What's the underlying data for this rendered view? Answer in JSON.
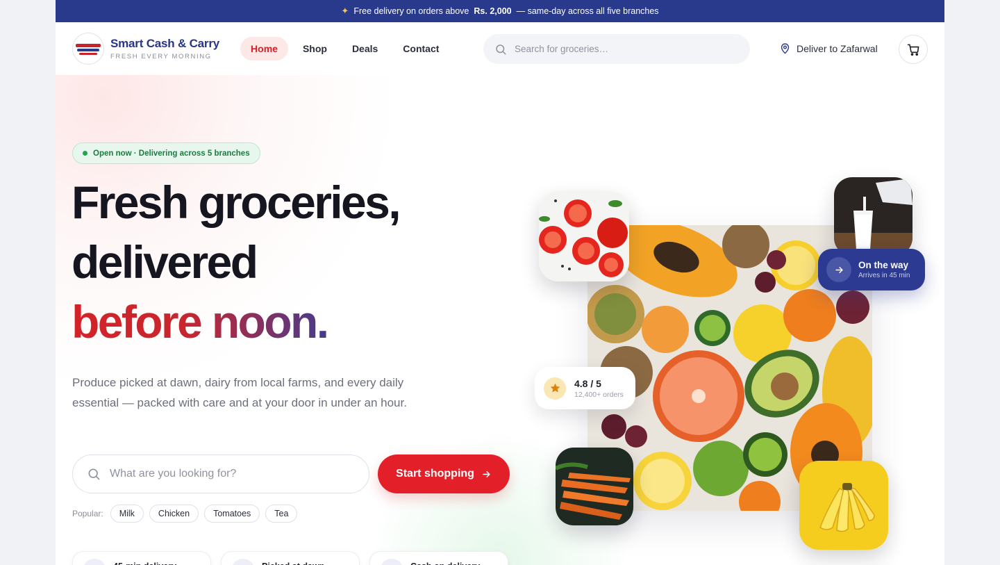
{
  "announcement": {
    "prefix": "Free delivery on orders above",
    "amount": "Rs. 2,000",
    "suffix": "— same-day across all five branches"
  },
  "brand": {
    "name": "Smart Cash & Carry",
    "tagline": "FRESH EVERY MORNING"
  },
  "nav": {
    "items": [
      {
        "label": "Home",
        "active": true
      },
      {
        "label": "Shop",
        "active": false
      },
      {
        "label": "Deals",
        "active": false
      },
      {
        "label": "Contact",
        "active": false
      }
    ]
  },
  "header_search": {
    "placeholder": "Search for groceries…"
  },
  "delivery": {
    "label": "Deliver to Zafarwal"
  },
  "hero": {
    "badge": "Open now · Delivering across 5 branches",
    "headline_line1": "Fresh groceries,",
    "headline_line2": "delivered",
    "headline_line3": "before noon.",
    "lead": "Produce picked at dawn, dairy from local farms, and every daily essential — packed with care and at your door in under an hour.",
    "search_placeholder": "What are you looking for?",
    "cta_label": "Start shopping",
    "popular_label": "Popular:",
    "popular_chips": [
      "Milk",
      "Chicken",
      "Tomatoes",
      "Tea"
    ],
    "features": [
      "45-min delivery",
      "Picked at dawn",
      "Cash on delivery"
    ]
  },
  "status_card": {
    "title": "On the way",
    "subtitle": "Arrives in 45 min"
  },
  "rating_card": {
    "title": "4.8 / 5",
    "subtitle": "12,400+ orders"
  },
  "colors": {
    "brand_blue": "#293a8c",
    "accent_red": "#e3202a",
    "success_green": "#22a552"
  }
}
